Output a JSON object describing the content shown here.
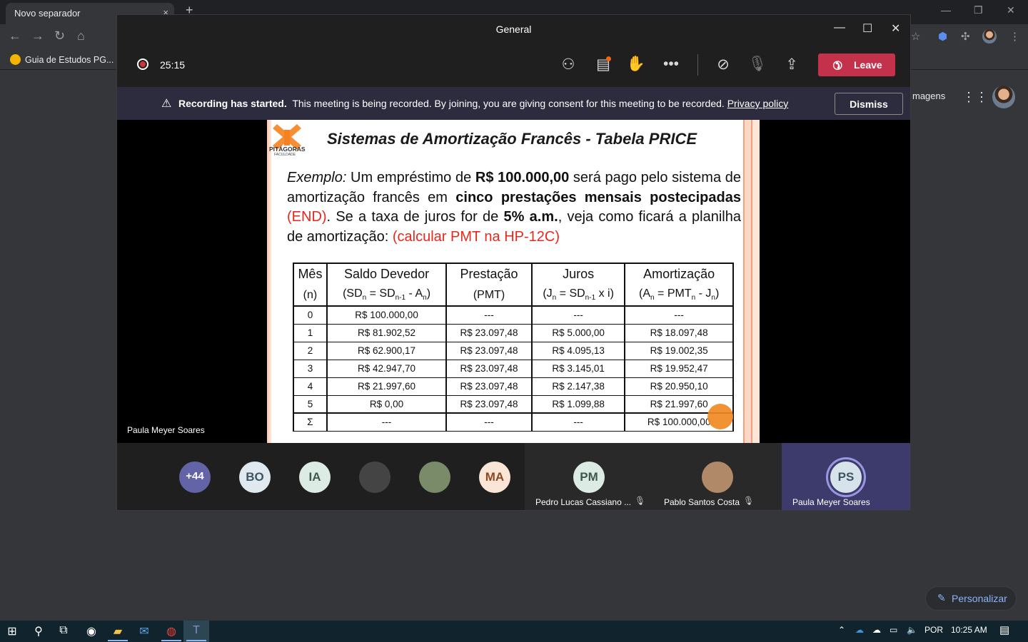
{
  "chrome": {
    "tab_title": "Novo separador",
    "tab_close": "×",
    "new_tab": "+",
    "bookmark": "Guia de Estudos PG...",
    "images_link": "magens",
    "personalize_label": "Personalizar"
  },
  "teams": {
    "window_title": "General",
    "timer": "25:15",
    "leave_label": "Leave",
    "banner": {
      "bold": "Recording has started.",
      "text": "This meeting is being recorded. By joining, you are giving consent for this meeting to be recorded.",
      "privacy_link": "Privacy policy",
      "dismiss_label": "Dismiss"
    },
    "presenter_name": "Paula Meyer Soares"
  },
  "slide": {
    "logo_text": "PITÁGORAS",
    "logo_sub": "FACULDADE",
    "title": "Sistemas de Amortização Francês - Tabela PRICE",
    "paragraph": {
      "exemplo": "Exemplo:",
      "t1": " Um empréstimo de ",
      "amount": "R$ 100.000,00",
      "t2": " será pago pelo sistema de amortização francês em ",
      "installments": "cinco prestações mensais postecipadas",
      "end": " (END)",
      "t3": ". Se a taxa de juros for de ",
      "rate": "5% a.m.",
      "t4": ", veja como ficará a planilha de amortização: ",
      "hint": "(calcular PMT na HP-12C)"
    },
    "table": {
      "headers": [
        "Mês",
        "Saldo Devedor",
        "Prestação",
        "Juros",
        "Amortização"
      ],
      "sub_n": "(n)",
      "sub_pmt": "(PMT)",
      "rows": [
        [
          "0",
          "R$ 100.000,00",
          "---",
          "---",
          "---"
        ],
        [
          "1",
          "R$ 81.902,52",
          "R$ 23.097,48",
          "R$ 5.000,00",
          "R$ 18.097,48"
        ],
        [
          "2",
          "R$ 62.900,17",
          "R$ 23.097,48",
          "R$ 4.095,13",
          "R$ 19.002,35"
        ],
        [
          "3",
          "R$ 42.947,70",
          "R$ 23.097,48",
          "R$ 3.145,01",
          "R$ 19.952,47"
        ],
        [
          "4",
          "R$ 21.997,60",
          "R$ 23.097,48",
          "R$ 2.147,38",
          "R$ 20.950,10"
        ],
        [
          "5",
          "R$ 0,00",
          "R$ 23.097,48",
          "R$ 1.099,88",
          "R$ 21.997,60"
        ],
        [
          "Σ",
          "---",
          "---",
          "---",
          "R$ 100.000,00"
        ]
      ]
    }
  },
  "participants": {
    "overflow": "+44",
    "avatars": [
      {
        "initials": "BO",
        "bg": "#dfe9ef",
        "fg": "#3d5463"
      },
      {
        "initials": "IA",
        "bg": "#dcebe4",
        "fg": "#3c5a4d"
      },
      {
        "initials": "",
        "bg": "#444444",
        "fg": "#ffffff"
      },
      {
        "initials": "",
        "bg": "#7a8b6a",
        "fg": "#ffffff"
      },
      {
        "initials": "MA",
        "bg": "#fbe5d6",
        "fg": "#8a4a22"
      }
    ],
    "tiles": [
      {
        "name": "Pedro Lucas Cassiano ...",
        "initials": "PM",
        "bg": "#dcebe4",
        "fg": "#3c5a4d"
      },
      {
        "name": "Pablo Santos Costa",
        "initials": "",
        "bg": "#b08a68",
        "fg": "#ffffff"
      },
      {
        "name": "Paula Meyer Soares",
        "initials": "PS",
        "bg": "#d7e3ea",
        "fg": "#3d5463"
      }
    ]
  },
  "taskbar": {
    "language": "POR",
    "time": "10:25 AM"
  },
  "colors": {
    "leave_red": "#c4314b",
    "banner_bg": "#2d2c3e",
    "teams_purple": "#6264a7",
    "laser": "#f08a24"
  }
}
